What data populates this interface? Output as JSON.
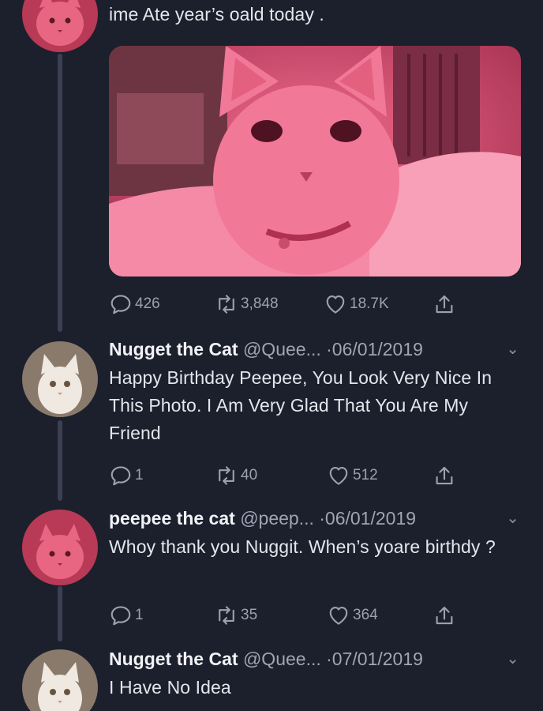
{
  "tweets": [
    {
      "text": "ime Ate year’s oald today .",
      "stats": {
        "replies": "426",
        "retweets": "3,848",
        "likes": "18.7K"
      }
    },
    {
      "name": "Nugget the Cat",
      "handle": "@Quee...",
      "date": "·06/01/2019",
      "text": "Happy Birthday Peepee, You Look Very Nice In This Photo. I Am Very Glad That You Are My Friend",
      "stats": {
        "replies": "1",
        "retweets": "40",
        "likes": "512"
      }
    },
    {
      "name": "peepee the cat",
      "handle": "@peep...",
      "date": "·06/01/2019",
      "text": "Whoy thank you Nuggit. When’s yoare birthdy ?",
      "stats": {
        "replies": "1",
        "retweets": "35",
        "likes": "364"
      }
    },
    {
      "name": "Nugget the Cat",
      "handle": "@Quee...",
      "date": "·07/01/2019",
      "text": "I Have No Idea"
    }
  ],
  "icons": {
    "reply": "reply-icon",
    "retweet": "retweet-icon",
    "like": "heart-icon",
    "share": "share-icon",
    "more": "chevron-down-icon"
  },
  "colors": {
    "background": "#1c1f2c",
    "muted_text": "#9ca1b0",
    "thread_line": "#3b4054"
  }
}
